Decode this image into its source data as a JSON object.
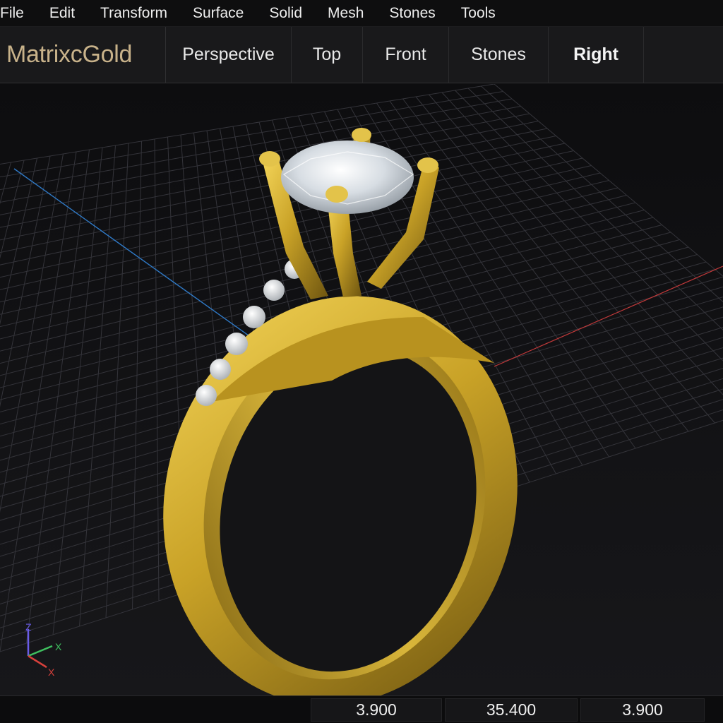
{
  "menu": [
    "File",
    "Edit",
    "Transform",
    "Surface",
    "Solid",
    "Mesh",
    "Stones",
    "Tools"
  ],
  "brand": "MatrixcGold",
  "tabs": [
    {
      "label": "Perspective",
      "active": false
    },
    {
      "label": "Top",
      "active": false
    },
    {
      "label": "Front",
      "active": false
    },
    {
      "label": "Stones",
      "active": false
    },
    {
      "label": "Right",
      "active": true
    }
  ],
  "axes": {
    "z": "Z",
    "x": "X",
    "y": "X"
  },
  "status": {
    "coords": [
      "3.900",
      "35.400",
      "3.900"
    ]
  },
  "colors": {
    "gold": "#c9a227",
    "grid": "#3a3a3e",
    "axis_blue": "#2f7ac8",
    "axis_red": "#c0393a",
    "brand": "#c8b28a"
  }
}
